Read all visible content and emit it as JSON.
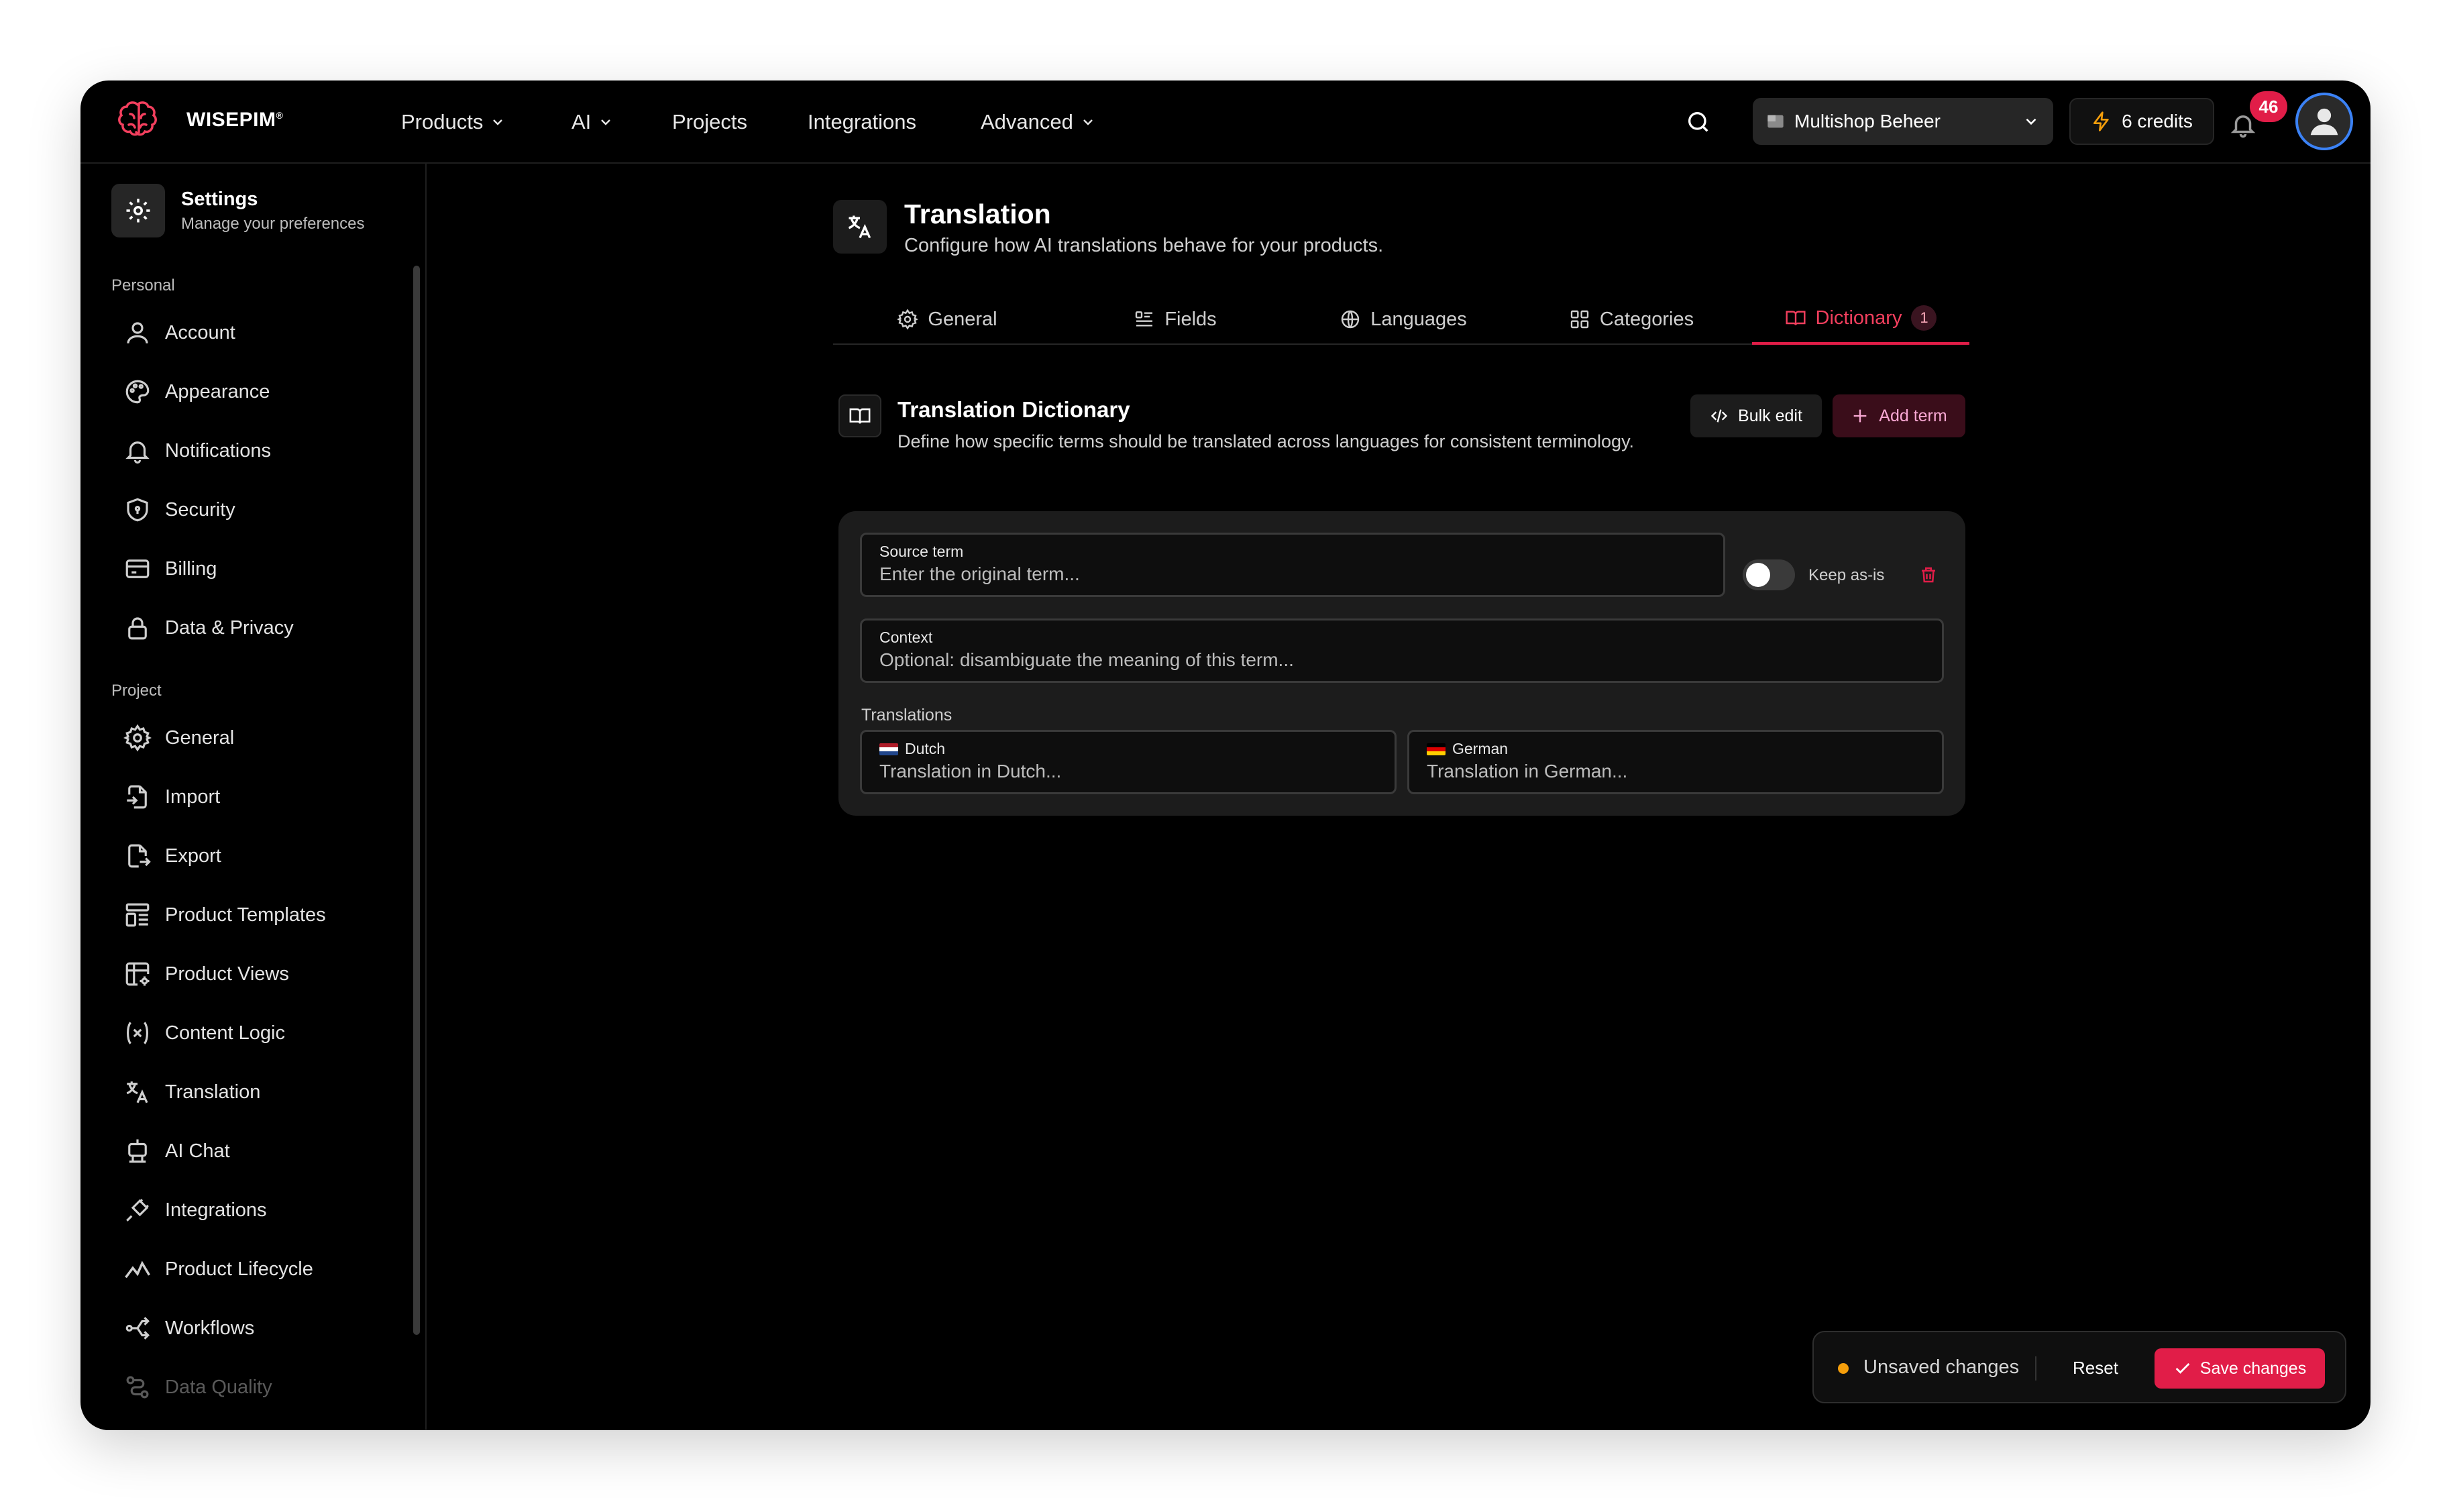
{
  "app": {
    "brand": "WISEPIM",
    "brand_mark": "®"
  },
  "topnav": {
    "items": [
      {
        "label": "Products",
        "has_dropdown": true
      },
      {
        "label": "AI",
        "has_dropdown": true
      },
      {
        "label": "Projects",
        "has_dropdown": false
      },
      {
        "label": "Integrations",
        "has_dropdown": false
      },
      {
        "label": "Advanced",
        "has_dropdown": true
      }
    ],
    "shop_selector": "Multishop Beheer",
    "credits": "6 credits",
    "notification_count": "46"
  },
  "sidebar": {
    "title": "Settings",
    "subtitle": "Manage your preferences",
    "personal_label": "Personal",
    "personal_items": [
      {
        "label": "Account",
        "icon": "user-icon"
      },
      {
        "label": "Appearance",
        "icon": "palette-icon"
      },
      {
        "label": "Notifications",
        "icon": "bell-icon"
      },
      {
        "label": "Security",
        "icon": "shield-icon"
      },
      {
        "label": "Billing",
        "icon": "credit-card-icon"
      },
      {
        "label": "Data & Privacy",
        "icon": "lock-icon"
      }
    ],
    "project_label": "Project",
    "project_items": [
      {
        "label": "General",
        "icon": "gear-icon"
      },
      {
        "label": "Import",
        "icon": "file-import-icon"
      },
      {
        "label": "Export",
        "icon": "file-export-icon"
      },
      {
        "label": "Product Templates",
        "icon": "template-icon"
      },
      {
        "label": "Product Views",
        "icon": "table-icon"
      },
      {
        "label": "Content Logic",
        "icon": "variable-icon"
      },
      {
        "label": "Translation",
        "icon": "translate-icon"
      },
      {
        "label": "AI Chat",
        "icon": "robot-icon"
      },
      {
        "label": "Integrations",
        "icon": "plug-icon"
      },
      {
        "label": "Product Lifecycle",
        "icon": "chart-line-icon"
      },
      {
        "label": "Workflows",
        "icon": "workflow-icon"
      },
      {
        "label": "Data Quality",
        "icon": "data-quality-icon"
      }
    ]
  },
  "page": {
    "title": "Translation",
    "subtitle": "Configure how AI translations behave for your products."
  },
  "tabs": [
    {
      "label": "General",
      "icon": "gear-icon"
    },
    {
      "label": "Fields",
      "icon": "list-icon"
    },
    {
      "label": "Languages",
      "icon": "globe-icon"
    },
    {
      "label": "Categories",
      "icon": "grid-icon"
    },
    {
      "label": "Dictionary",
      "icon": "book-icon",
      "count": "1",
      "active": true
    }
  ],
  "dictionary": {
    "title": "Translation Dictionary",
    "description": "Define how specific terms should be translated across languages for consistent terminology.",
    "bulk_edit": "Bulk edit",
    "add_term": "Add term",
    "entry": {
      "source_label": "Source term",
      "source_placeholder": "Enter the original term...",
      "keep_label": "Keep as-is",
      "keep_value": false,
      "context_label": "Context",
      "context_placeholder": "Optional: disambiguate the meaning of this term...",
      "translations_label": "Translations",
      "translations": [
        {
          "language": "Dutch",
          "placeholder": "Translation in Dutch...",
          "flag_colors": [
            "#ae1c28",
            "#ffffff",
            "#21468b"
          ]
        },
        {
          "language": "German",
          "placeholder": "Translation in German...",
          "flag_colors": [
            "#000000",
            "#dd0000",
            "#ffce00"
          ]
        }
      ]
    }
  },
  "savebar": {
    "status": "Unsaved changes",
    "reset": "Reset",
    "save": "Save changes"
  },
  "colors": {
    "accent": "#e11d48",
    "warning_dot": "#f59e0b",
    "avatar_ring": "#3b82f6"
  }
}
